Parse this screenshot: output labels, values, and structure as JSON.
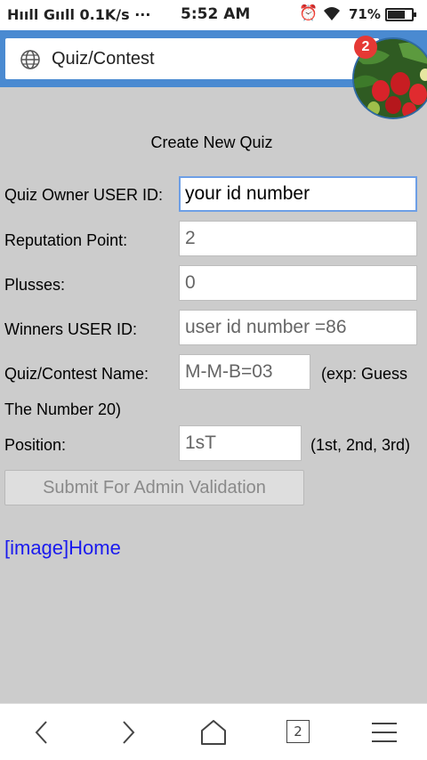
{
  "status_bar": {
    "signal": "Hᴵᴵᴵl Gᴵᴵl 0.1K/s ···",
    "time": "5:52 AM",
    "battery_percent": "71%",
    "battery_level": 0.71
  },
  "browser": {
    "page_title": "Quiz/Contest",
    "notification_count": "2",
    "tab_count": "2"
  },
  "form": {
    "heading": "Create New Quiz",
    "owner_label": "Quiz Owner USER ID:",
    "owner_value": "your id number",
    "reputation_label": "Reputation Point:",
    "reputation_value": "2",
    "plusses_label": "Plusses:",
    "plusses_value": "0",
    "winners_label": "Winners USER ID:",
    "winners_value": "user id number =86",
    "name_label": "Quiz/Contest Name:",
    "name_value": "M-M-B=03",
    "name_hint_a": "(exp: Guess",
    "name_hint_b": "The Number 20)",
    "position_label": "Position:",
    "position_value": "1sT",
    "position_hint": "(1st, 2nd, 3rd)",
    "submit_label": "Submit For Admin Validation"
  },
  "home_link": "[image]Home",
  "icons": {
    "back": "chevron-left-icon",
    "forward": "chevron-right-icon",
    "home": "home-icon",
    "menu": "menu-icon",
    "globe": "globe-icon",
    "alarm": "alarm-icon",
    "wifi": "wifi-icon"
  }
}
